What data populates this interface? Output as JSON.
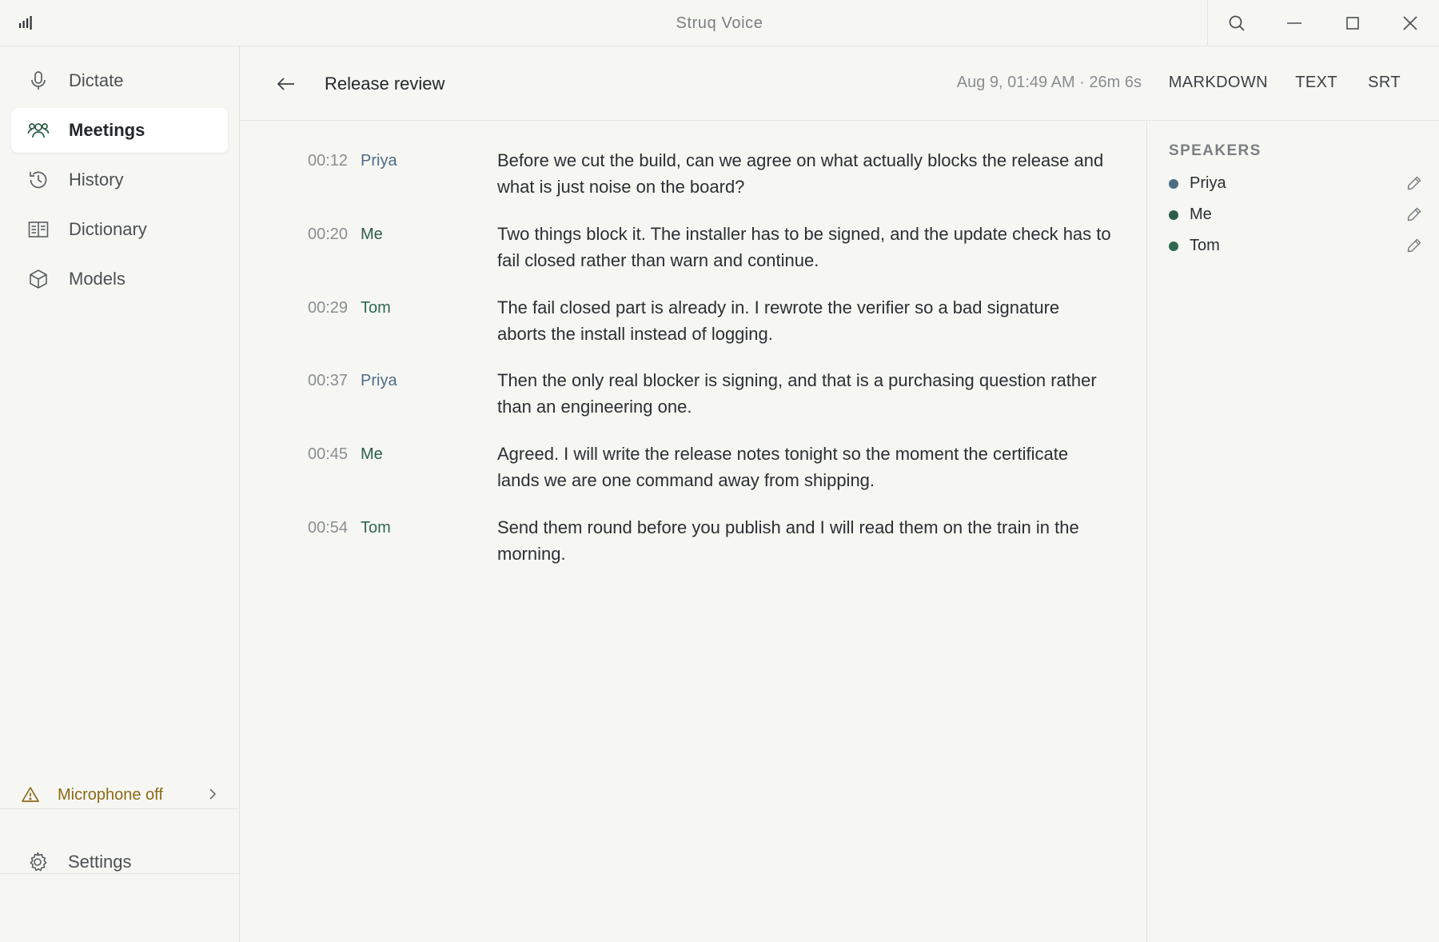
{
  "window": {
    "title": "Struq Voice",
    "icons": [
      "signal-logo-icon",
      "search-icon",
      "minimize-icon",
      "maximize-icon",
      "close-icon"
    ]
  },
  "sidebar": {
    "items": [
      {
        "label": "Dictate",
        "icon": "microphone-icon",
        "active": false
      },
      {
        "label": "Meetings",
        "icon": "people-icon",
        "active": true
      },
      {
        "label": "History",
        "icon": "history-icon",
        "active": false
      },
      {
        "label": "Dictionary",
        "icon": "book-icon",
        "active": false
      },
      {
        "label": "Models",
        "icon": "cube-icon",
        "active": false
      }
    ],
    "mic_warning": {
      "label": "Microphone off",
      "icon": "warning-icon"
    },
    "settings": {
      "label": "Settings",
      "icon": "gear-icon"
    }
  },
  "meeting": {
    "title": "Release review",
    "meta": "Aug 9, 01:49 AM · 26m 6s",
    "exports": [
      "MARKDOWN",
      "TEXT",
      "SRT"
    ]
  },
  "transcript": [
    {
      "time": "00:12",
      "speaker": "Priya",
      "text": "Before we cut the build, can we agree on what actually blocks the release and what is just noise on the board?"
    },
    {
      "time": "00:20",
      "speaker": "Me",
      "text": "Two things block it. The installer has to be signed, and the update check has to fail closed rather than warn and continue."
    },
    {
      "time": "00:29",
      "speaker": "Tom",
      "text": "The fail closed part is already in. I rewrote the verifier so a bad signature aborts the install instead of logging."
    },
    {
      "time": "00:37",
      "speaker": "Priya",
      "text": "Then the only real blocker is signing, and that is a purchasing question rather than an engineering one."
    },
    {
      "time": "00:45",
      "speaker": "Me",
      "text": "Agreed. I will write the release notes tonight so the moment the certificate lands we are one command away from shipping."
    },
    {
      "time": "00:54",
      "speaker": "Tom",
      "text": "Send them round before you publish and I will read them on the train in the morning."
    }
  ],
  "speakers": {
    "heading": "SPEAKERS",
    "list": [
      {
        "name": "Priya",
        "color": "#4d6d86"
      },
      {
        "name": "Me",
        "color": "#2c5e47"
      },
      {
        "name": "Tom",
        "color": "#2f6a4e"
      }
    ]
  },
  "colors": {
    "accent": "#2c5e47",
    "priya": "#4d6d86",
    "me": "#2c5e47",
    "tom": "#2f6a4e",
    "warning": "#8c6a16"
  }
}
